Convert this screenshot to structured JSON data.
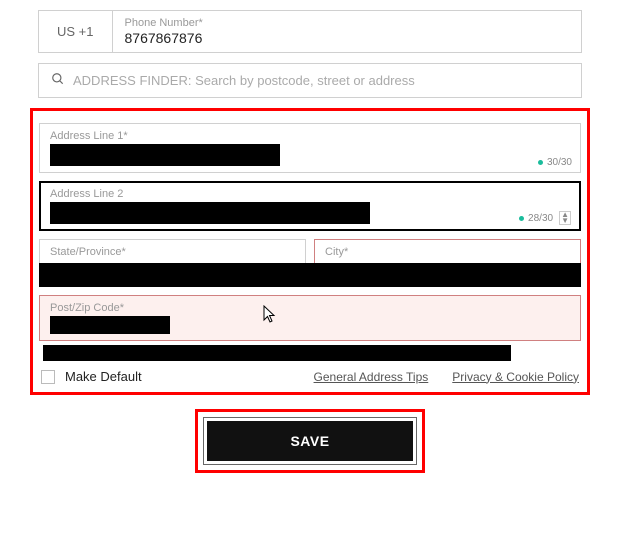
{
  "phone": {
    "prefix": "US +1",
    "label": "Phone Number*",
    "value": "8767867876"
  },
  "search": {
    "placeholder": "ADDRESS FINDER: Search by postcode, street or address"
  },
  "addr1": {
    "label": "Address Line 1*",
    "counter": "30/30"
  },
  "addr2": {
    "label": "Address Line 2",
    "counter": "28/30"
  },
  "state": {
    "label": "State/Province*"
  },
  "city": {
    "label": "City*"
  },
  "zip": {
    "label": "Post/Zip Code*"
  },
  "footer": {
    "make_default": "Make Default",
    "tips": "General Address Tips",
    "policy": "Privacy & Cookie Policy"
  },
  "save": "SAVE"
}
